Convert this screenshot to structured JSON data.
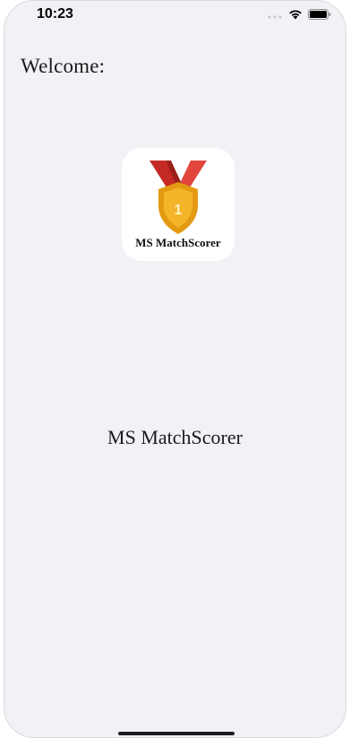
{
  "status_bar": {
    "time": "10:23",
    "icons": [
      "signal-dots-icon",
      "wifi-icon",
      "battery-icon"
    ]
  },
  "screen": {
    "welcome_text": "Welcome:",
    "app_icon": {
      "caption": "MS MatchScorer",
      "medal_number": "1"
    },
    "app_title": "MS MatchScorer"
  },
  "colors": {
    "background": "#f2f1f6",
    "ribbon": "#d6342c",
    "medal": "#f2a81d"
  }
}
